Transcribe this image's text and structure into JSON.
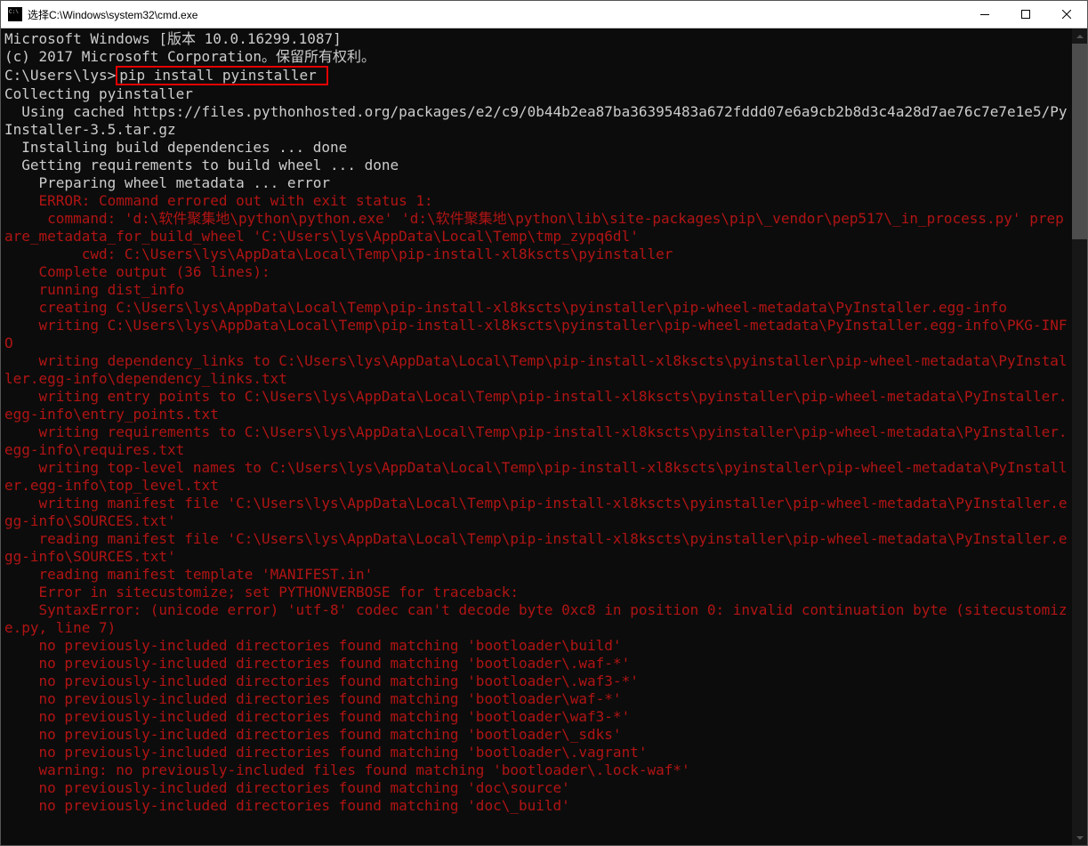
{
  "window": {
    "title": "选择C:\\Windows\\system32\\cmd.exe"
  },
  "terminal": {
    "prompt_prefix": "C:\\Users\\lys>",
    "highlighted_command": "pip install pyinstaller ",
    "lines_white_top": [
      "Microsoft Windows [版本 10.0.16299.1087]",
      "(c) 2017 Microsoft Corporation。保留所有权利。",
      ""
    ],
    "lines_white_mid": [
      "Collecting pyinstaller",
      "  Using cached https://files.pythonhosted.org/packages/e2/c9/0b44b2ea87ba36395483a672fddd07e6a9cb2b8d3c4a28d7ae76c7e7e1e5/PyInstaller-3.5.tar.gz",
      "  Installing build dependencies ... done",
      "  Getting requirements to build wheel ... done",
      "    Preparing wheel metadata ... error"
    ],
    "lines_red": [
      "    ERROR: Command errored out with exit status 1:",
      "     command: 'd:\\软件聚集地\\python\\python.exe' 'd:\\软件聚集地\\python\\lib\\site-packages\\pip\\_vendor\\pep517\\_in_process.py' prepare_metadata_for_build_wheel 'C:\\Users\\lys\\AppData\\Local\\Temp\\tmp_zypq6dl'",
      "         cwd: C:\\Users\\lys\\AppData\\Local\\Temp\\pip-install-xl8kscts\\pyinstaller",
      "    Complete output (36 lines):",
      "    running dist_info",
      "    creating C:\\Users\\lys\\AppData\\Local\\Temp\\pip-install-xl8kscts\\pyinstaller\\pip-wheel-metadata\\PyInstaller.egg-info",
      "    writing C:\\Users\\lys\\AppData\\Local\\Temp\\pip-install-xl8kscts\\pyinstaller\\pip-wheel-metadata\\PyInstaller.egg-info\\PKG-INFO",
      "    writing dependency_links to C:\\Users\\lys\\AppData\\Local\\Temp\\pip-install-xl8kscts\\pyinstaller\\pip-wheel-metadata\\PyInstaller.egg-info\\dependency_links.txt",
      "    writing entry points to C:\\Users\\lys\\AppData\\Local\\Temp\\pip-install-xl8kscts\\pyinstaller\\pip-wheel-metadata\\PyInstaller.egg-info\\entry_points.txt",
      "    writing requirements to C:\\Users\\lys\\AppData\\Local\\Temp\\pip-install-xl8kscts\\pyinstaller\\pip-wheel-metadata\\PyInstaller.egg-info\\requires.txt",
      "    writing top-level names to C:\\Users\\lys\\AppData\\Local\\Temp\\pip-install-xl8kscts\\pyinstaller\\pip-wheel-metadata\\PyInstaller.egg-info\\top_level.txt",
      "    writing manifest file 'C:\\Users\\lys\\AppData\\Local\\Temp\\pip-install-xl8kscts\\pyinstaller\\pip-wheel-metadata\\PyInstaller.egg-info\\SOURCES.txt'",
      "    reading manifest file 'C:\\Users\\lys\\AppData\\Local\\Temp\\pip-install-xl8kscts\\pyinstaller\\pip-wheel-metadata\\PyInstaller.egg-info\\SOURCES.txt'",
      "    reading manifest template 'MANIFEST.in'",
      "    Error in sitecustomize; set PYTHONVERBOSE for traceback:",
      "    SyntaxError: (unicode error) 'utf-8' codec can't decode byte 0xc8 in position 0: invalid continuation byte (sitecustomize.py, line 7)",
      "    no previously-included directories found matching 'bootloader\\build'",
      "    no previously-included directories found matching 'bootloader\\.waf-*'",
      "    no previously-included directories found matching 'bootloader\\.waf3-*'",
      "    no previously-included directories found matching 'bootloader\\waf-*'",
      "    no previously-included directories found matching 'bootloader\\waf3-*'",
      "    no previously-included directories found matching 'bootloader\\_sdks'",
      "    no previously-included directories found matching 'bootloader\\.vagrant'",
      "    warning: no previously-included files found matching 'bootloader\\.lock-waf*'",
      "    no previously-included directories found matching 'doc\\source'",
      "    no previously-included directories found matching 'doc\\_build'"
    ]
  }
}
